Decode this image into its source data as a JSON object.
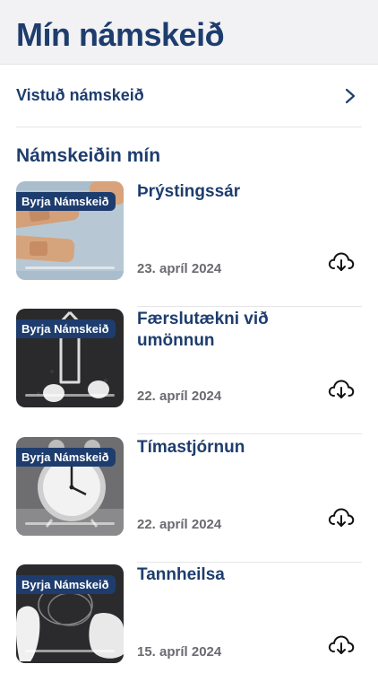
{
  "header": {
    "title": "Mín námskeið"
  },
  "saved": {
    "label": "Vistuð námskeið"
  },
  "section": {
    "title": "Námskeiðin mín"
  },
  "courses": [
    {
      "badge": "Byrja Námskeið",
      "title": "Þrýstingssár",
      "date": "23. apríl 2024",
      "progress": 0
    },
    {
      "badge": "Byrja Námskeið",
      "title": "Færslutækni við umönnun",
      "date": "22. apríl 2024",
      "progress": 0
    },
    {
      "badge": "Byrja Námskeið",
      "title": "Tímastjórnun",
      "date": "22. apríl 2024",
      "progress": 0
    },
    {
      "badge": "Byrja Námskeið",
      "title": "Tannheilsa",
      "date": "15. apríl 2024",
      "progress": 0
    }
  ],
  "icons": {
    "chevron": "chevron-right-icon",
    "download": "cloud-download-icon"
  },
  "colors": {
    "primary": "#1e3d6e",
    "muted": "#6a6a70",
    "header_bg": "#f2f2f4"
  }
}
